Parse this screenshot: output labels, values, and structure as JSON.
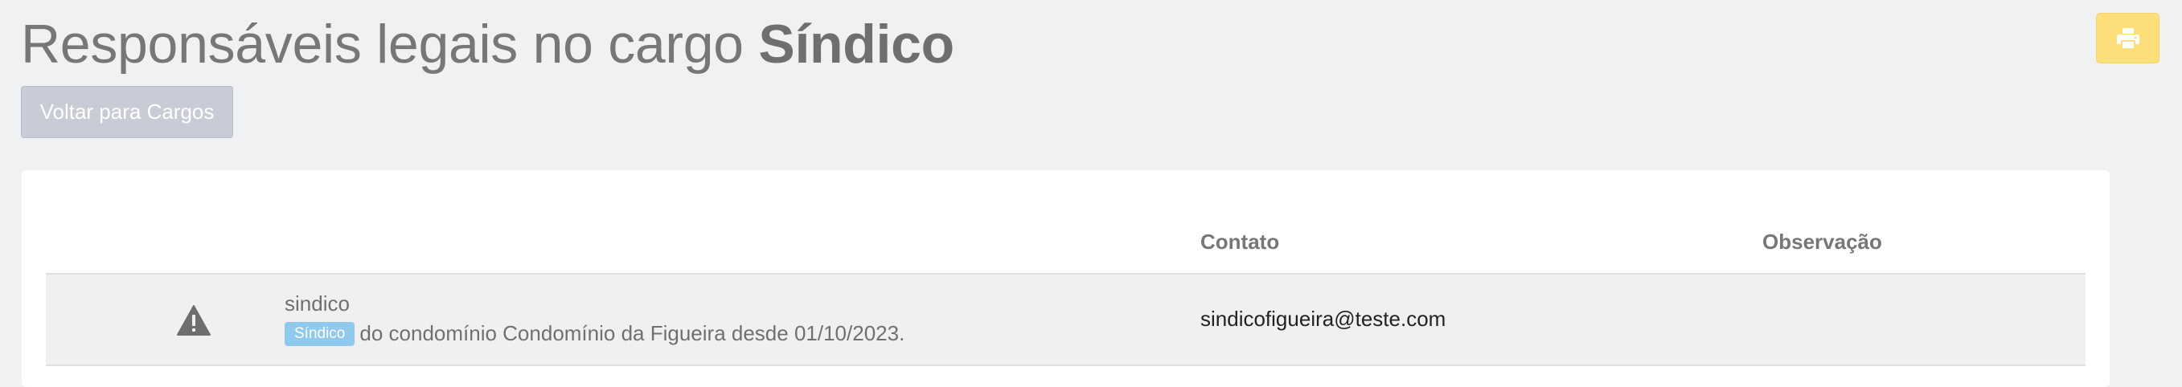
{
  "page": {
    "title_prefix": "Responsáveis legais no cargo",
    "title_role": "Síndico"
  },
  "actions": {
    "back_label": "Voltar para Cargos",
    "print_icon": "print-icon"
  },
  "colors": {
    "print_button": "#fcde7b",
    "badge": "#8fcaee",
    "back_button": "#c9cbd6"
  },
  "table": {
    "columns": [
      "",
      "",
      "Contato",
      "Observação"
    ],
    "rows": [
      {
        "status_icon": "warning-icon",
        "name": "sindico",
        "badge": "Síndico",
        "description": "do condomínio Condomínio da Figueira desde 01/10/2023.",
        "contact": "sindicofigueira@teste.com",
        "observation": ""
      }
    ]
  }
}
